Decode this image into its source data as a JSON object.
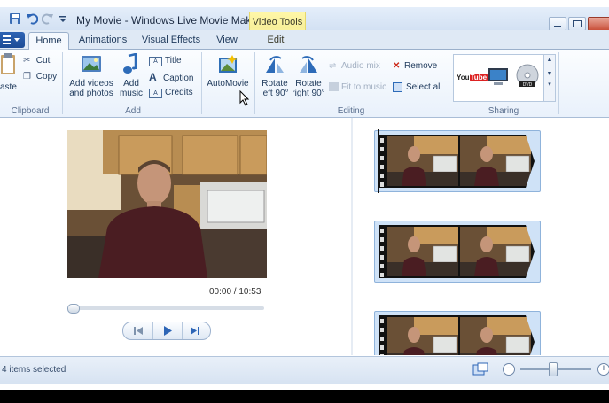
{
  "window": {
    "title": "My Movie - Windows Live Movie Maker",
    "contextual_group": "Video Tools"
  },
  "tabs": [
    {
      "label": "Home",
      "active": true
    },
    {
      "label": "Animations",
      "active": false
    },
    {
      "label": "Visual Effects",
      "active": false
    },
    {
      "label": "View",
      "active": false
    },
    {
      "label": "Edit",
      "active": false
    }
  ],
  "ribbon": {
    "clipboard": {
      "paste_label": "aste",
      "cut_label": "Cut",
      "copy_label": "Copy",
      "group_label": "Clipboard"
    },
    "add": {
      "add_videos_line1": "Add videos",
      "add_videos_line2": "and photos",
      "add_music_line1": "Add",
      "add_music_line2": "music",
      "title_label": "Title",
      "caption_label": "Caption",
      "credits_label": "Credits",
      "group_label": "Add"
    },
    "automovie": {
      "label": "AutoMovie"
    },
    "editing": {
      "rotate_left_line1": "Rotate",
      "rotate_left_line2": "left 90°",
      "rotate_right_line1": "Rotate",
      "rotate_right_line2": "right 90°",
      "audio_mix_label": "Audio mix",
      "fit_to_music_label": "Fit to music",
      "remove_label": "Remove",
      "select_all_label": "Select all",
      "group_label": "Editing"
    },
    "sharing": {
      "youtube_label": "YouTube",
      "group_label": "Sharing"
    }
  },
  "player": {
    "time_display": "00:00 / 10:53",
    "position_fraction": 0.0
  },
  "storyboard": {
    "clip_count_visible": 3
  },
  "status": {
    "items_selected": "4 items selected",
    "zoom_fraction": 0.45
  },
  "colors": {
    "accent_blue": "#1d4c96",
    "context_yellow": "#f7ef9a",
    "ribbon_bg": "#e9f1fb"
  }
}
